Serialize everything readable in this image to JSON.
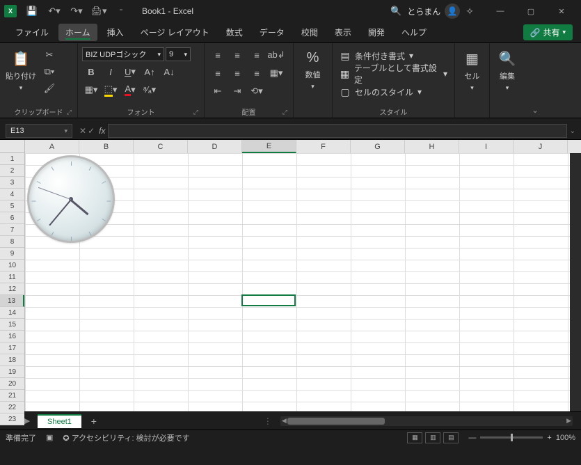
{
  "titlebar": {
    "title": "Book1 - Excel",
    "username": "とらまん"
  },
  "tabs": {
    "file": "ファイル",
    "home": "ホーム",
    "insert": "挿入",
    "pagelayout": "ページ レイアウト",
    "formulas": "数式",
    "data": "データ",
    "review": "校閲",
    "view": "表示",
    "developer": "開発",
    "help": "ヘルプ",
    "share": "共有"
  },
  "ribbon": {
    "clipboard": {
      "label": "クリップボード",
      "paste": "貼り付け"
    },
    "font": {
      "label": "フォント",
      "name": "BIZ UDPゴシック",
      "size": "9"
    },
    "alignment": {
      "label": "配置"
    },
    "number": {
      "label": "数値"
    },
    "styles": {
      "label": "スタイル",
      "cond": "条件付き書式",
      "table": "テーブルとして書式設定",
      "cell": "セルのスタイル"
    },
    "cells": {
      "label": "セル"
    },
    "editing": {
      "label": "編集"
    }
  },
  "namebox": "E13",
  "columns": [
    "A",
    "B",
    "C",
    "D",
    "E",
    "F",
    "G",
    "H",
    "I",
    "J"
  ],
  "rows": [
    "1",
    "2",
    "3",
    "4",
    "5",
    "6",
    "7",
    "8",
    "9",
    "10",
    "11",
    "12",
    "13",
    "14",
    "15",
    "16",
    "17",
    "18",
    "19",
    "20",
    "21",
    "22",
    "23"
  ],
  "sheettab": "Sheet1",
  "status": {
    "ready": "準備完了",
    "accessibility": "アクセシビリティ: 検討が必要です",
    "zoom": "100%"
  }
}
